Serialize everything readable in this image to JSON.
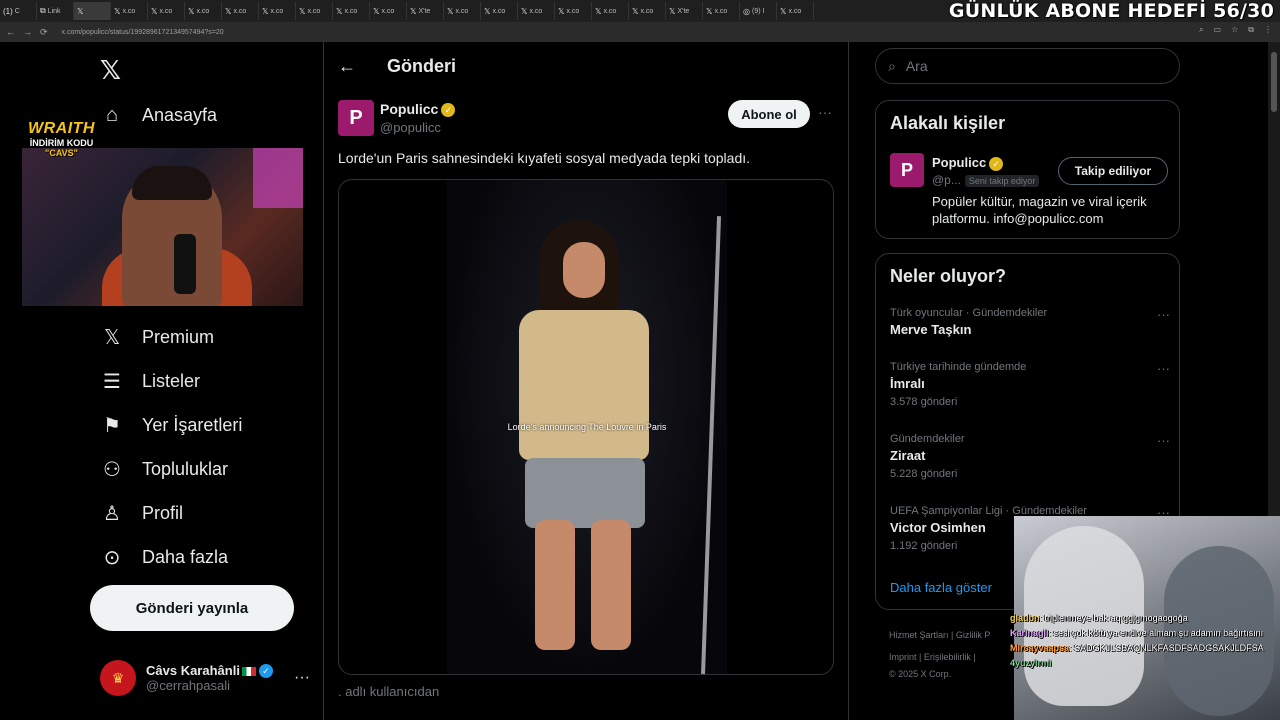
{
  "overlay": {
    "goal_text": "GÜNLÜK ABONE HEDEFİ 56/30"
  },
  "browser": {
    "tabs": [
      {
        "fav": "(1)",
        "label": "C"
      },
      {
        "fav": "⧉",
        "label": "Link"
      },
      {
        "fav": "𝕏",
        "label": ""
      },
      {
        "fav": "𝕏",
        "label": "x.co"
      },
      {
        "fav": "𝕏",
        "label": "x.co"
      },
      {
        "fav": "𝕏",
        "label": "x.co"
      },
      {
        "fav": "𝕏",
        "label": "x.co"
      },
      {
        "fav": "𝕏",
        "label": "x.co"
      },
      {
        "fav": "𝕏",
        "label": "x.co"
      },
      {
        "fav": "𝕏",
        "label": "x.co"
      },
      {
        "fav": "𝕏",
        "label": "x.co"
      },
      {
        "fav": "𝕏",
        "label": "X'te"
      },
      {
        "fav": "𝕏",
        "label": "x.co"
      },
      {
        "fav": "𝕏",
        "label": "x.co"
      },
      {
        "fav": "𝕏",
        "label": "x.co"
      },
      {
        "fav": "𝕏",
        "label": "x.co"
      },
      {
        "fav": "𝕏",
        "label": "x.co"
      },
      {
        "fav": "𝕏",
        "label": "x.co"
      },
      {
        "fav": "𝕏",
        "label": "X'te"
      },
      {
        "fav": "𝕏",
        "label": "x.co"
      },
      {
        "fav": "◎",
        "label": "(9) I"
      },
      {
        "fav": "𝕏",
        "label": "x.co"
      }
    ],
    "url": "x.com/populicc/status/1992896172134957494?s=20"
  },
  "sponsor": {
    "brand": "WRAITH",
    "code_line1": "İNDİRİM KODU",
    "code_line2": "\"CAVS\""
  },
  "nav": {
    "home": "Anasayfa",
    "premium": "Premium",
    "lists": "Listeler",
    "bookmarks": "Yer İşaretleri",
    "communities": "Topluluklar",
    "profile": "Profil",
    "more": "Daha fazla",
    "post_button": "Gönderi yayınla"
  },
  "me": {
    "name": "Câvs Karahânli",
    "handle": "@cerrahpasali"
  },
  "post": {
    "page_title": "Gönderi",
    "author_name": "Populicc",
    "author_handle": "@populicc",
    "subscribe_label": "Abone ol",
    "text": "Lorde'un Paris sahnesindeki kıyafeti sosyal medyada tepki topladı.",
    "video_caption": "Lorde's announcing The Louvre in Paris",
    "footer_text": ". adlı kullanıcıdan"
  },
  "search": {
    "placeholder": "Ara"
  },
  "relevant": {
    "heading": "Alakalı kişiler",
    "name": "Populicc",
    "handle": "@p...",
    "follows_you": "Seni takip ediyor",
    "following_label": "Takip ediliyor",
    "bio": "Popüler kültür, magazin ve viral içerik platformu. info@populicc.com"
  },
  "trends": {
    "heading": "Neler oluyor?",
    "items": [
      {
        "context": "Türk oyuncular · Gündemdekiler",
        "title": "Merve Taşkın",
        "count": ""
      },
      {
        "context": "Türkiye tarihinde gündemde",
        "title": "İmralı",
        "count": "3.578 gönderi"
      },
      {
        "context": "Gündemdekiler",
        "title": "Ziraat",
        "count": "5.228 gönderi"
      },
      {
        "context": "UEFA Şampiyonlar Ligi · Gündemdekiler",
        "title": "Victor Osimhen",
        "count": "1.192 gönderi"
      }
    ],
    "show_more": "Daha fazla göster"
  },
  "footer": {
    "line1": "Hizmet Şartları  |  Gizlilik P",
    "line2": "Imprint  |  Erişilebilirlik  |",
    "line3": "© 2025 X Corp."
  },
  "chat": [
    {
      "user": "glaubn",
      "msg": ": triplenmeye bak aq ggjgmogaogoğa"
    },
    {
      "user": "Karinagil",
      "msg": ": sesi çok kötü ya endive almam şu adamın bağırtısını"
    },
    {
      "user": "Mircayvaapsa",
      "msg": ": SADGKJLSBAQNLKFASDFSADGSAKJLDFSA"
    },
    {
      "user": "4yuzyirmi",
      "msg": ""
    }
  ]
}
